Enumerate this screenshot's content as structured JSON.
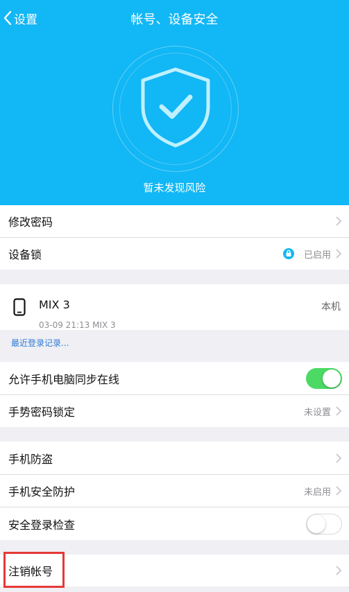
{
  "nav": {
    "back_label": "设置",
    "title": "帐号、设备安全"
  },
  "header": {
    "status_text": "暂未发现风险"
  },
  "rows": {
    "change_password": "修改密码",
    "device_lock": "设备锁",
    "device_lock_status": "已启用",
    "allow_sync": "允许手机电脑同步在线",
    "gesture_lock": "手势密码锁定",
    "gesture_lock_status": "未设置",
    "anti_theft": "手机防盗",
    "phone_protection": "手机安全防护",
    "phone_protection_status": "未启用",
    "login_check": "安全登录检查",
    "cancel_account": "注销帐号"
  },
  "device": {
    "name": "MIX 3",
    "meta": "03-09 21:13 MIX 3",
    "self_label": "本机",
    "recent_link": "最近登录记录..."
  },
  "toggles": {
    "allow_sync": true,
    "login_check": false
  },
  "colors": {
    "header": "#12b7f5",
    "toggle_on": "#4cd964",
    "link": "#2e7bd6",
    "highlight": "#e53935"
  }
}
